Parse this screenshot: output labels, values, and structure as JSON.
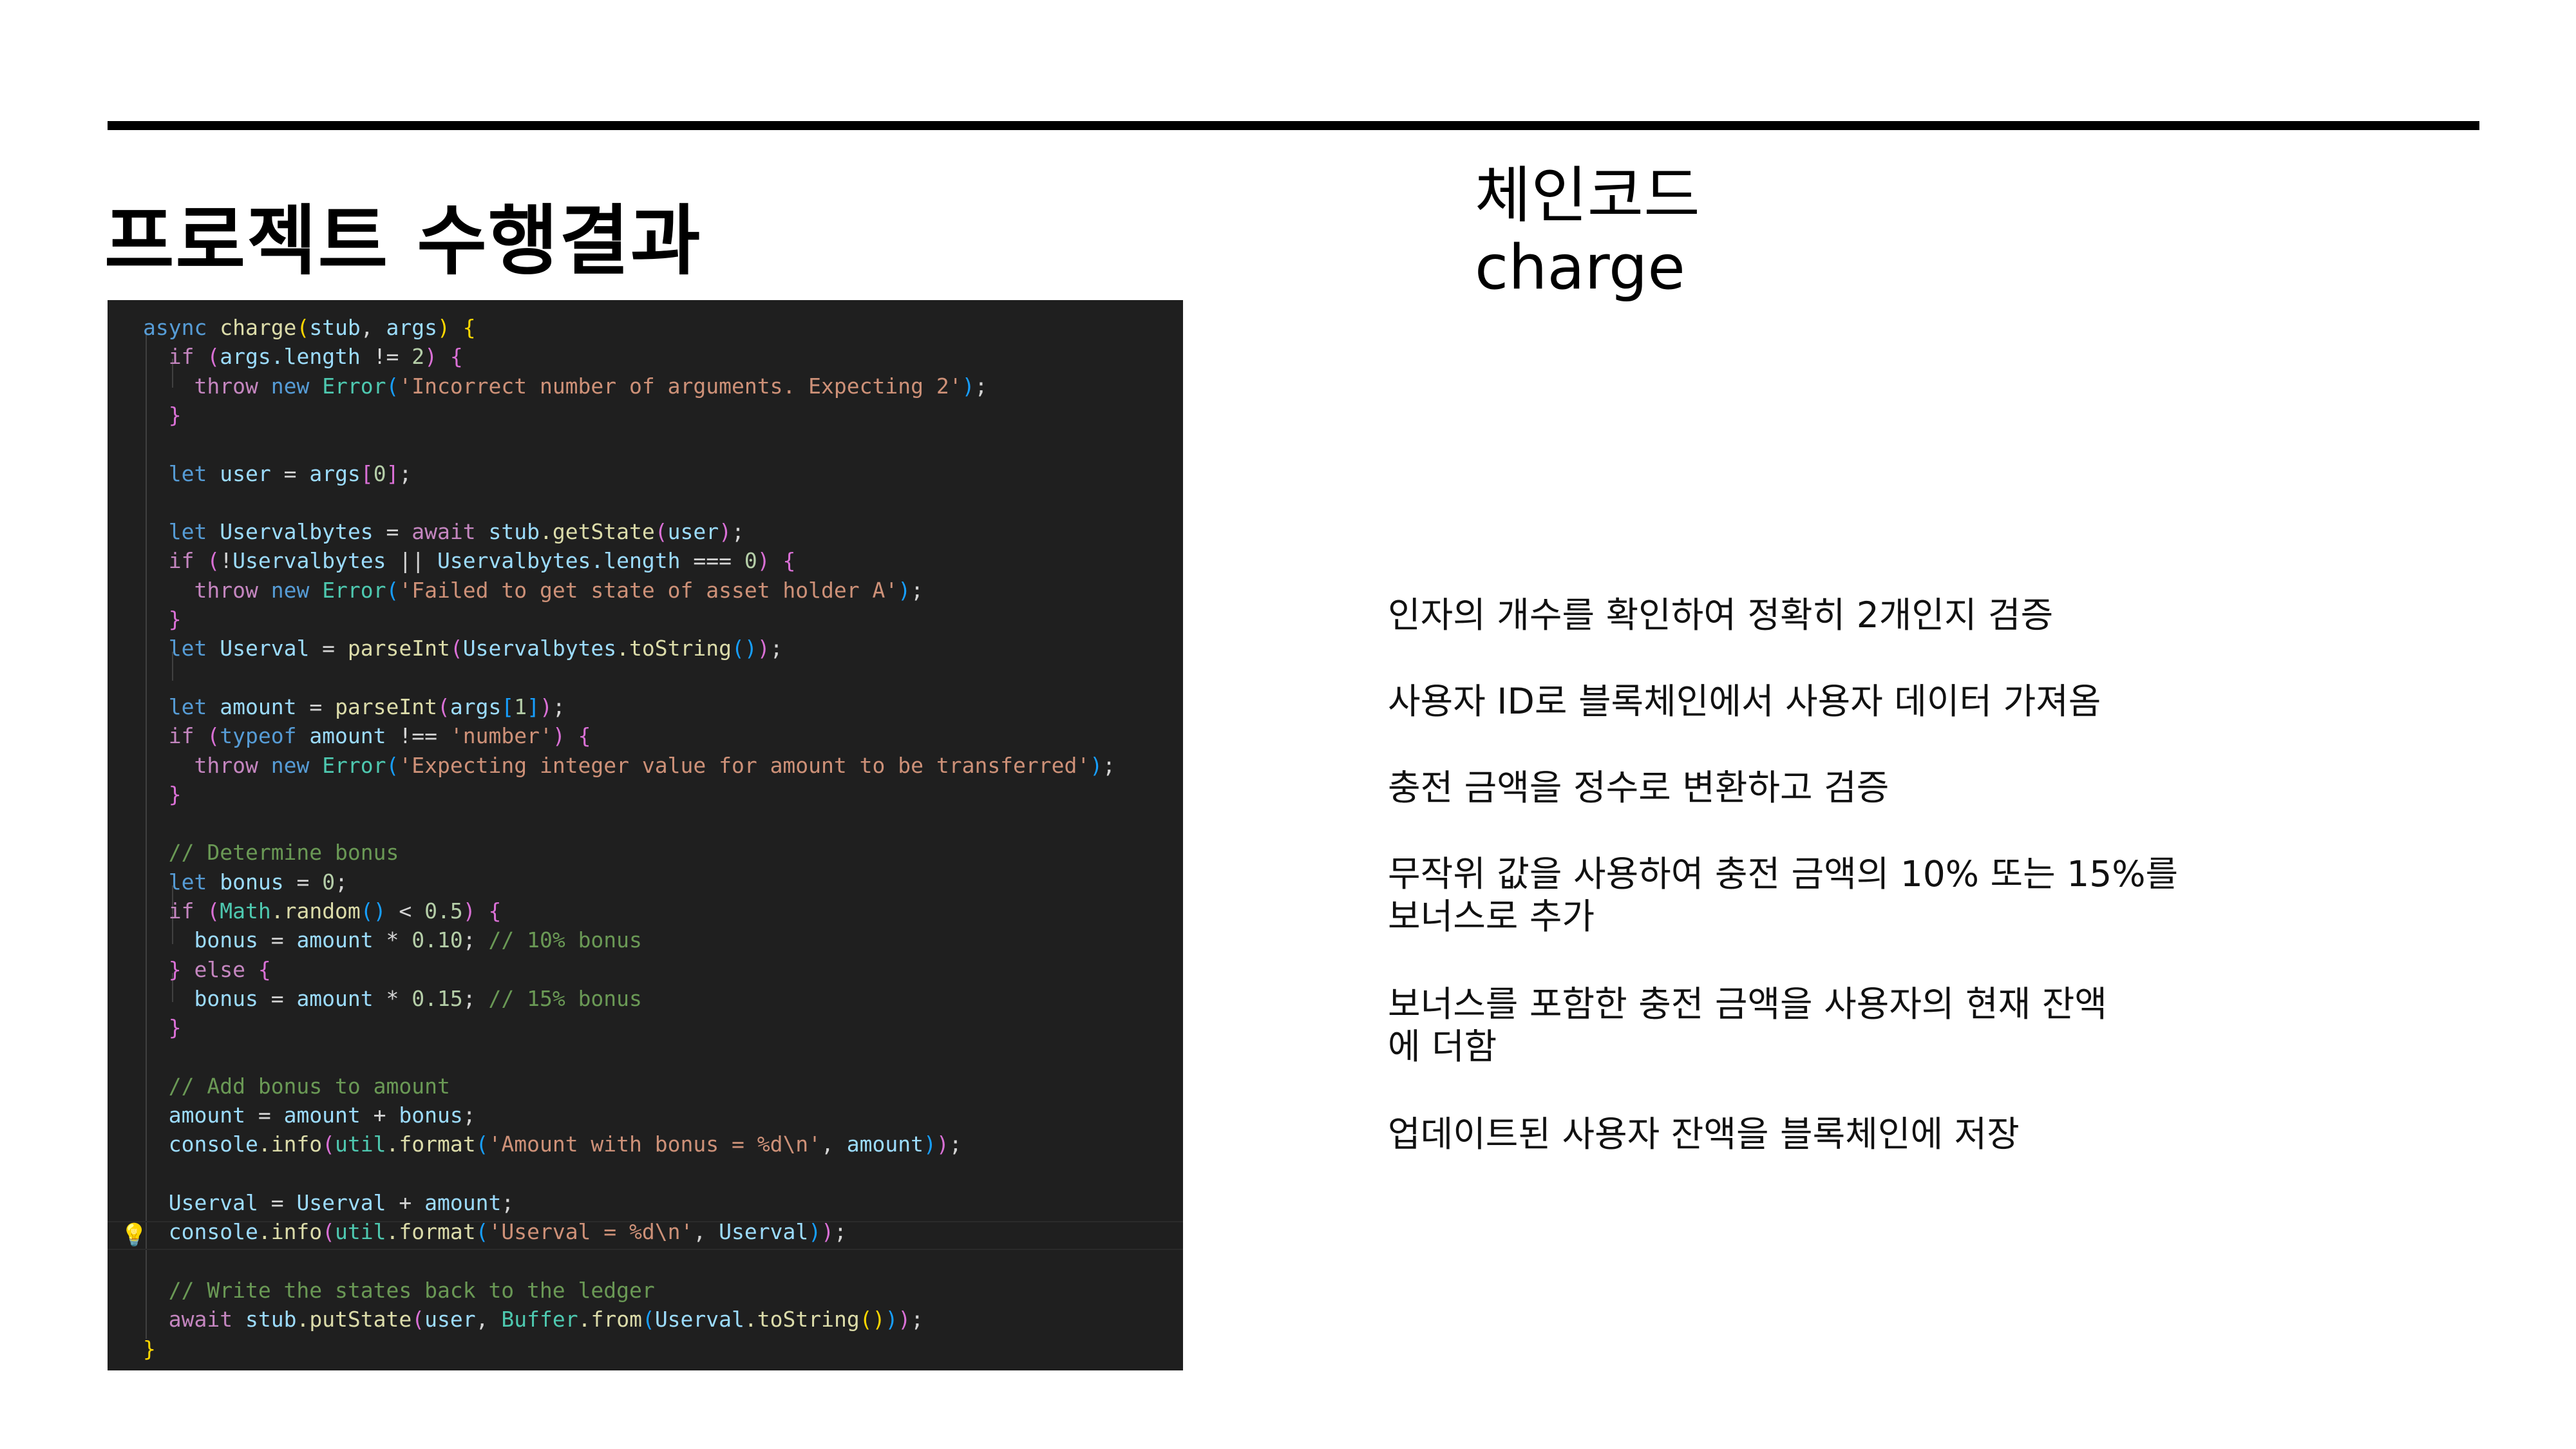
{
  "slide": {
    "title": "프로젝트 수행결과",
    "heading_line1": "체인코드",
    "heading_line2": "charge",
    "descriptions": [
      "인자의 개수를 확인하여 정확히 2개인지 검증",
      "사용자 ID로 블록체인에서 사용자 데이터 가져옴",
      "충전 금액을 정수로 변환하고 검증",
      "무작위 값을 사용하여 충전 금액의 10% 또는 15%를",
      "보너스로 추가",
      "보너스를 포함한 충전 금액을 사용자의 현재 잔액",
      "에 더함",
      "업데이트된 사용자 잔액을 블록체인에 저장"
    ]
  },
  "editor": {
    "lightbulb_icon": "lightbulb-icon",
    "code_lines": [
      [
        [
          "kw",
          "async "
        ],
        [
          "fn",
          "charge"
        ],
        [
          "b1",
          "("
        ],
        [
          "vr",
          "stub"
        ],
        [
          "",
          "、 "
        ],
        [
          "vr",
          "args"
        ],
        [
          "b1",
          ")"
        ],
        [
          "",
          ""
        ],
        [
          "b1",
          " {"
        ]
      ],
      [
        [
          "",
          "  "
        ],
        [
          "kc",
          "if "
        ],
        [
          "b2",
          "("
        ],
        [
          "vr",
          "args"
        ],
        [
          "",
          ""
        ],
        [
          "vr",
          ".length"
        ],
        [
          "",
          " != "
        ],
        [
          "nm",
          "2"
        ],
        [
          "b2",
          ")"
        ],
        [
          "b2",
          " {"
        ]
      ],
      [
        [
          "",
          "    "
        ],
        [
          "kc",
          "throw "
        ],
        [
          "kw",
          "new "
        ],
        [
          "ty",
          "Error"
        ],
        [
          "b3",
          "("
        ],
        [
          "st",
          "'Incorrect number of arguments. Expecting 2'"
        ],
        [
          "b3",
          ")"
        ],
        [
          "",
          ";"
        ]
      ],
      [
        [
          "",
          "  "
        ],
        [
          "b2",
          "}"
        ]
      ],
      [
        [
          "",
          ""
        ]
      ],
      [
        [
          "",
          "  "
        ],
        [
          "kw",
          "let "
        ],
        [
          "vr",
          "user"
        ],
        [
          "",
          " = "
        ],
        [
          "vr",
          "args"
        ],
        [
          "b2",
          "["
        ],
        [
          "nm",
          "0"
        ],
        [
          "b2",
          "]"
        ],
        [
          "",
          ";"
        ]
      ],
      [
        [
          "",
          ""
        ]
      ],
      [
        [
          "",
          "  "
        ],
        [
          "kw",
          "let "
        ],
        [
          "vr",
          "Uservalbytes"
        ],
        [
          "",
          " = "
        ],
        [
          "kc",
          "await "
        ],
        [
          "vr",
          "stub"
        ],
        [
          "",
          ""
        ],
        [
          "fn",
          ".getState"
        ],
        [
          "b2",
          "("
        ],
        [
          "vr",
          "user"
        ],
        [
          "b2",
          ")"
        ],
        [
          "",
          ";"
        ]
      ],
      [
        [
          "",
          "  "
        ],
        [
          "kc",
          "if "
        ],
        [
          "b2",
          "("
        ],
        [
          "",
          "!"
        ],
        [
          "vr",
          "Uservalbytes"
        ],
        [
          "",
          " || "
        ],
        [
          "vr",
          "Uservalbytes"
        ],
        [
          "vr",
          ".length"
        ],
        [
          "",
          " === "
        ],
        [
          "nm",
          "0"
        ],
        [
          "b2",
          ")"
        ],
        [
          "b2",
          " {"
        ]
      ],
      [
        [
          "",
          "    "
        ],
        [
          "kc",
          "throw "
        ],
        [
          "kw",
          "new "
        ],
        [
          "ty",
          "Error"
        ],
        [
          "b3",
          "("
        ],
        [
          "st",
          "'Failed to get state of asset holder A'"
        ],
        [
          "b3",
          ")"
        ],
        [
          "",
          ";"
        ]
      ],
      [
        [
          "",
          "  "
        ],
        [
          "b2",
          "}"
        ]
      ],
      [
        [
          "",
          "  "
        ],
        [
          "kw",
          "let "
        ],
        [
          "vr",
          "Userval"
        ],
        [
          "",
          " = "
        ],
        [
          "fn",
          "parseInt"
        ],
        [
          "b2",
          "("
        ],
        [
          "vr",
          "Uservalbytes"
        ],
        [
          "fn",
          ".toString"
        ],
        [
          "b3",
          "()"
        ],
        [
          "b2",
          ")"
        ],
        [
          "",
          ";"
        ]
      ],
      [
        [
          "",
          ""
        ]
      ],
      [
        [
          "",
          "  "
        ],
        [
          "kw",
          "let "
        ],
        [
          "vr",
          "amount"
        ],
        [
          "",
          " = "
        ],
        [
          "fn",
          "parseInt"
        ],
        [
          "b2",
          "("
        ],
        [
          "vr",
          "args"
        ],
        [
          "b3",
          "["
        ],
        [
          "nm",
          "1"
        ],
        [
          "b3",
          "]"
        ],
        [
          "b2",
          ")"
        ],
        [
          "",
          ";"
        ]
      ],
      [
        [
          "",
          "  "
        ],
        [
          "kc",
          "if "
        ],
        [
          "b2",
          "("
        ],
        [
          "kw",
          "typeof "
        ],
        [
          "vr",
          "amount"
        ],
        [
          "",
          " !== "
        ],
        [
          "st",
          "'number'"
        ],
        [
          "b2",
          ")"
        ],
        [
          "b2",
          " {"
        ]
      ],
      [
        [
          "",
          "    "
        ],
        [
          "kc",
          "throw "
        ],
        [
          "kw",
          "new "
        ],
        [
          "ty",
          "Error"
        ],
        [
          "b3",
          "("
        ],
        [
          "st",
          "'Expecting integer value for amount to be transferred'"
        ],
        [
          "b3",
          ")"
        ],
        [
          "",
          ";"
        ]
      ],
      [
        [
          "",
          "  "
        ],
        [
          "b2",
          "}"
        ]
      ],
      [
        [
          "",
          ""
        ]
      ],
      [
        [
          "",
          "  "
        ],
        [
          "cm",
          "// Determine bonus"
        ]
      ],
      [
        [
          "",
          "  "
        ],
        [
          "kw",
          "let "
        ],
        [
          "vr",
          "bonus"
        ],
        [
          "",
          " = "
        ],
        [
          "nm",
          "0"
        ],
        [
          "",
          ";"
        ]
      ],
      [
        [
          "",
          "  "
        ],
        [
          "kc",
          "if "
        ],
        [
          "b2",
          "("
        ],
        [
          "ty",
          "Math"
        ],
        [
          "fn",
          ".random"
        ],
        [
          "b3",
          "()"
        ],
        [
          "",
          " < "
        ],
        [
          "nm",
          "0.5"
        ],
        [
          "b2",
          ")"
        ],
        [
          "b2",
          " {"
        ]
      ],
      [
        [
          "",
          "    "
        ],
        [
          "vr",
          "bonus"
        ],
        [
          "",
          " = "
        ],
        [
          "vr",
          "amount"
        ],
        [
          "",
          " * "
        ],
        [
          "nm",
          "0.10"
        ],
        [
          "",
          ";"
        ],
        [
          "cm",
          " // 10% bonus"
        ]
      ],
      [
        [
          "",
          "  "
        ],
        [
          "b2",
          "}"
        ],
        [
          "kc",
          " else "
        ],
        [
          "b2",
          "{"
        ]
      ],
      [
        [
          "",
          "    "
        ],
        [
          "vr",
          "bonus"
        ],
        [
          "",
          " = "
        ],
        [
          "vr",
          "amount"
        ],
        [
          "",
          " * "
        ],
        [
          "nm",
          "0.15"
        ],
        [
          "",
          ";"
        ],
        [
          "cm",
          " // 15% bonus"
        ]
      ],
      [
        [
          "",
          "  "
        ],
        [
          "b2",
          "}"
        ]
      ],
      [
        [
          "",
          ""
        ]
      ],
      [
        [
          "",
          "  "
        ],
        [
          "cm",
          "// Add bonus to amount"
        ]
      ],
      [
        [
          "",
          "  "
        ],
        [
          "vr",
          "amount"
        ],
        [
          "",
          " = "
        ],
        [
          "vr",
          "amount"
        ],
        [
          "",
          " + "
        ],
        [
          "vr",
          "bonus"
        ],
        [
          "",
          ";"
        ]
      ],
      [
        [
          "",
          "  "
        ],
        [
          "vr",
          "console"
        ],
        [
          "fn",
          ".info"
        ],
        [
          "b2",
          "("
        ],
        [
          "ty",
          "util"
        ],
        [
          "fn",
          ".format"
        ],
        [
          "b3",
          "("
        ],
        [
          "st",
          "'Amount with bonus = %d\\n'"
        ],
        [
          "",
          ", "
        ],
        [
          "vr",
          "amount"
        ],
        [
          "b3",
          ")"
        ],
        [
          "b2",
          ")"
        ],
        [
          "",
          ";"
        ]
      ],
      [
        [
          "",
          ""
        ]
      ],
      [
        [
          "",
          "  "
        ],
        [
          "vr",
          "Userval"
        ],
        [
          "",
          " = "
        ],
        [
          "vr",
          "Userval"
        ],
        [
          "",
          " + "
        ],
        [
          "vr",
          "amount"
        ],
        [
          "",
          ";"
        ]
      ],
      [
        [
          "",
          "  "
        ],
        [
          "vr",
          "console"
        ],
        [
          "fn",
          ".info"
        ],
        [
          "b2",
          "("
        ],
        [
          "ty",
          "util"
        ],
        [
          "fn",
          ".format"
        ],
        [
          "b3",
          "("
        ],
        [
          "st",
          "'Userval = %d\\n'"
        ],
        [
          "",
          ", "
        ],
        [
          "vr",
          "Userval"
        ],
        [
          "b3",
          ")"
        ],
        [
          "b2",
          ")"
        ],
        [
          "",
          ";"
        ]
      ],
      [
        [
          "",
          ""
        ]
      ],
      [
        [
          "",
          "  "
        ],
        [
          "cm",
          "// Write the states back to the ledger"
        ]
      ],
      [
        [
          "",
          "  "
        ],
        [
          "kc",
          "await "
        ],
        [
          "vr",
          "stub"
        ],
        [
          "fn",
          ".putState"
        ],
        [
          "b2",
          "("
        ],
        [
          "vr",
          "user"
        ],
        [
          "",
          ", "
        ],
        [
          "ty",
          "Buffer"
        ],
        [
          "fn",
          ".from"
        ],
        [
          "b3",
          "("
        ],
        [
          "vr",
          "Userval"
        ],
        [
          "fn",
          ".toString"
        ],
        [
          "b1",
          "()"
        ],
        [
          "b3",
          ")"
        ],
        [
          "b2",
          ")"
        ],
        [
          "",
          ";"
        ]
      ],
      [
        [
          "b1",
          "}"
        ]
      ]
    ]
  }
}
